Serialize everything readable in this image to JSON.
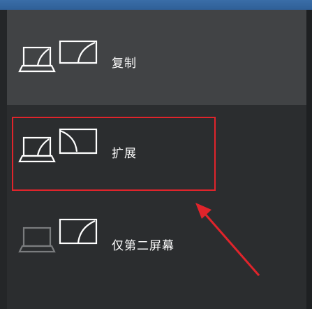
{
  "project_menu": {
    "options": [
      {
        "label": "复制",
        "selected": false
      },
      {
        "label": "扩展",
        "selected": true
      },
      {
        "label": "仅第二屏幕",
        "selected": false
      }
    ]
  },
  "annotation": {
    "highlight_color": "#e0242b",
    "arrow_color": "#e0242b"
  },
  "colors": {
    "panel_bg": "#2b2d2f",
    "hover_bg": "#414345",
    "text": "#ffffff"
  }
}
